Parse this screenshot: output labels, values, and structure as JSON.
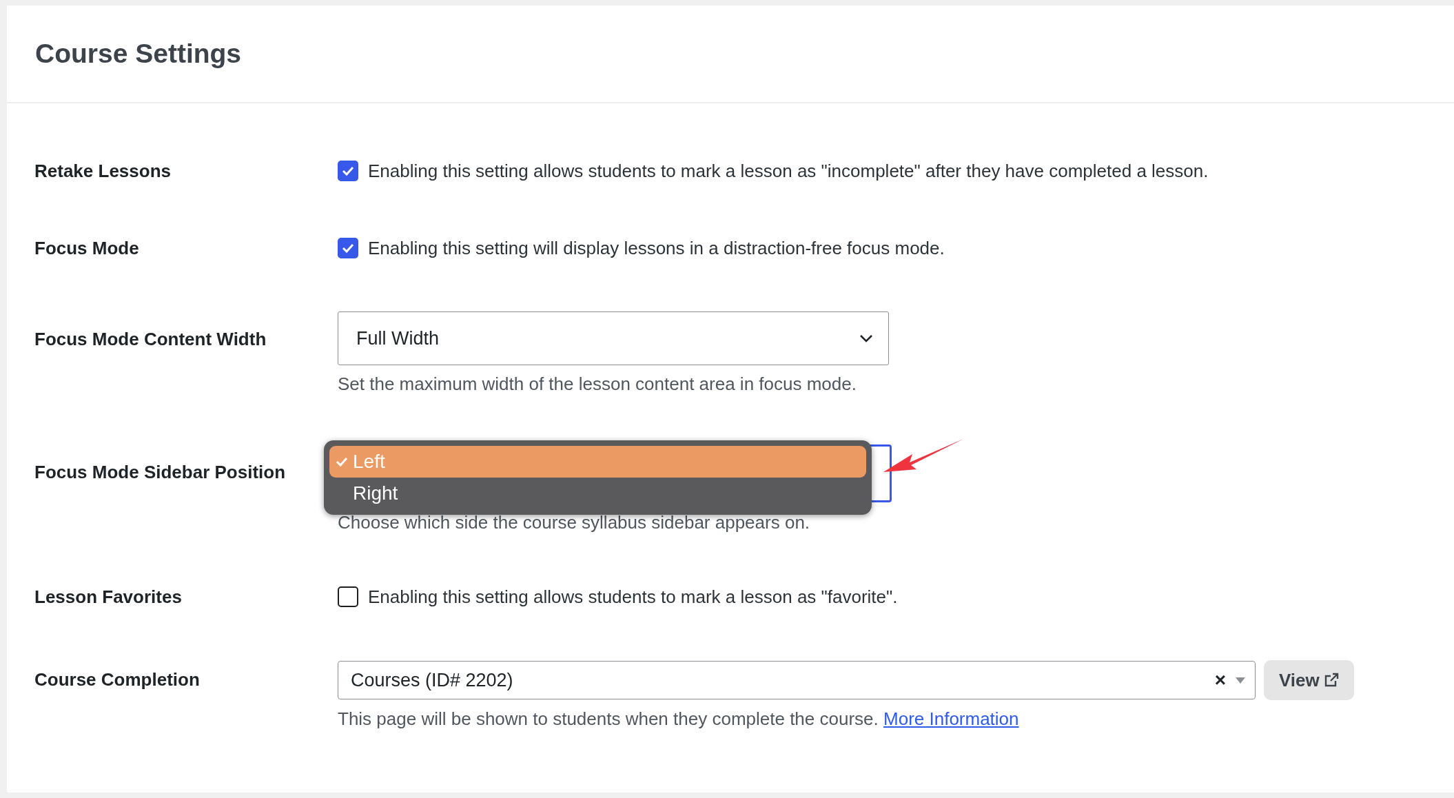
{
  "title": "Course Settings",
  "settings": [
    {
      "kind": "checkbox",
      "label": "Retake Lessons",
      "checked": true,
      "description": "Enabling this setting allows students to mark a lesson as \"incomplete\" after they have completed a lesson."
    },
    {
      "kind": "checkbox",
      "label": "Focus Mode",
      "checked": true,
      "description": "Enabling this setting will display lessons in a distraction-free focus mode."
    },
    {
      "kind": "select",
      "label": "Focus Mode Content Width",
      "value": "Full Width",
      "help": "Set the maximum width of the lesson content area in focus mode."
    },
    {
      "kind": "open-select",
      "label": "Focus Mode Sidebar Position",
      "options": [
        {
          "label": "Left",
          "selected": true
        },
        {
          "label": "Right",
          "selected": false
        }
      ],
      "help": "Choose which side the course syllabus sidebar appears on."
    },
    {
      "kind": "checkbox",
      "label": "Lesson Favorites",
      "checked": false,
      "description": "Enabling this setting allows students to mark a lesson as \"favorite\"."
    },
    {
      "kind": "page-select",
      "label": "Course Completion",
      "value": "Courses (ID# 2202)",
      "clear": "×",
      "button": "View",
      "help": "This page will be shown to students when they complete the course.",
      "link": "More Information"
    }
  ]
}
